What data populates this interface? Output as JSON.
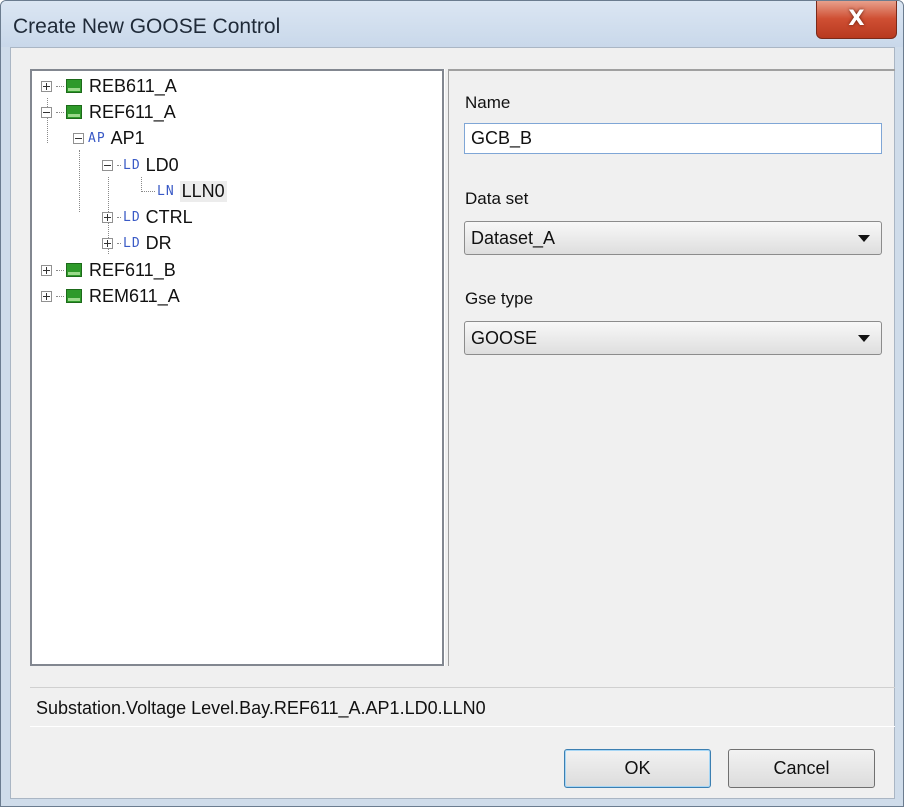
{
  "window": {
    "title": "Create New GOOSE Control",
    "close_label": "X"
  },
  "tree": [
    {
      "id": "reb611a",
      "tag": "",
      "label": "REB611_A",
      "icon": "ied-icon",
      "state": "collapsed"
    },
    {
      "id": "ref611a",
      "tag": "",
      "label": "REF611_A",
      "icon": "ied-icon",
      "state": "expanded"
    },
    {
      "id": "ap1",
      "tag": "AP",
      "label": "AP1",
      "state": "expanded"
    },
    {
      "id": "ld0",
      "tag": "LD",
      "label": "LD0",
      "state": "expanded"
    },
    {
      "id": "lln0",
      "tag": "LN",
      "label": "LLN0",
      "state": "leaf",
      "selected": true
    },
    {
      "id": "ctrl",
      "tag": "LD",
      "label": "CTRL",
      "state": "collapsed"
    },
    {
      "id": "dr",
      "tag": "LD",
      "label": "DR",
      "state": "collapsed"
    },
    {
      "id": "ref611b",
      "tag": "",
      "label": "REF611_B",
      "icon": "ied-icon",
      "state": "collapsed"
    },
    {
      "id": "rem611a",
      "tag": "",
      "label": "REM611_A",
      "icon": "ied-icon",
      "state": "collapsed"
    }
  ],
  "form": {
    "name_label": "Name",
    "name_value": "GCB_B",
    "dataset_label": "Data set",
    "dataset_value": "Dataset_A",
    "gse_type_label": "Gse type",
    "gse_type_value": "GOOSE"
  },
  "status": {
    "path": "Substation.Voltage Level.Bay.REF611_A.AP1.LD0.LLN0"
  },
  "buttons": {
    "ok": "OK",
    "cancel": "Cancel"
  },
  "colors": {
    "accent": "#3c7fb1",
    "close": "#cf4f33",
    "ied": "#2e9a2a",
    "tag": "#3a5ac6"
  }
}
